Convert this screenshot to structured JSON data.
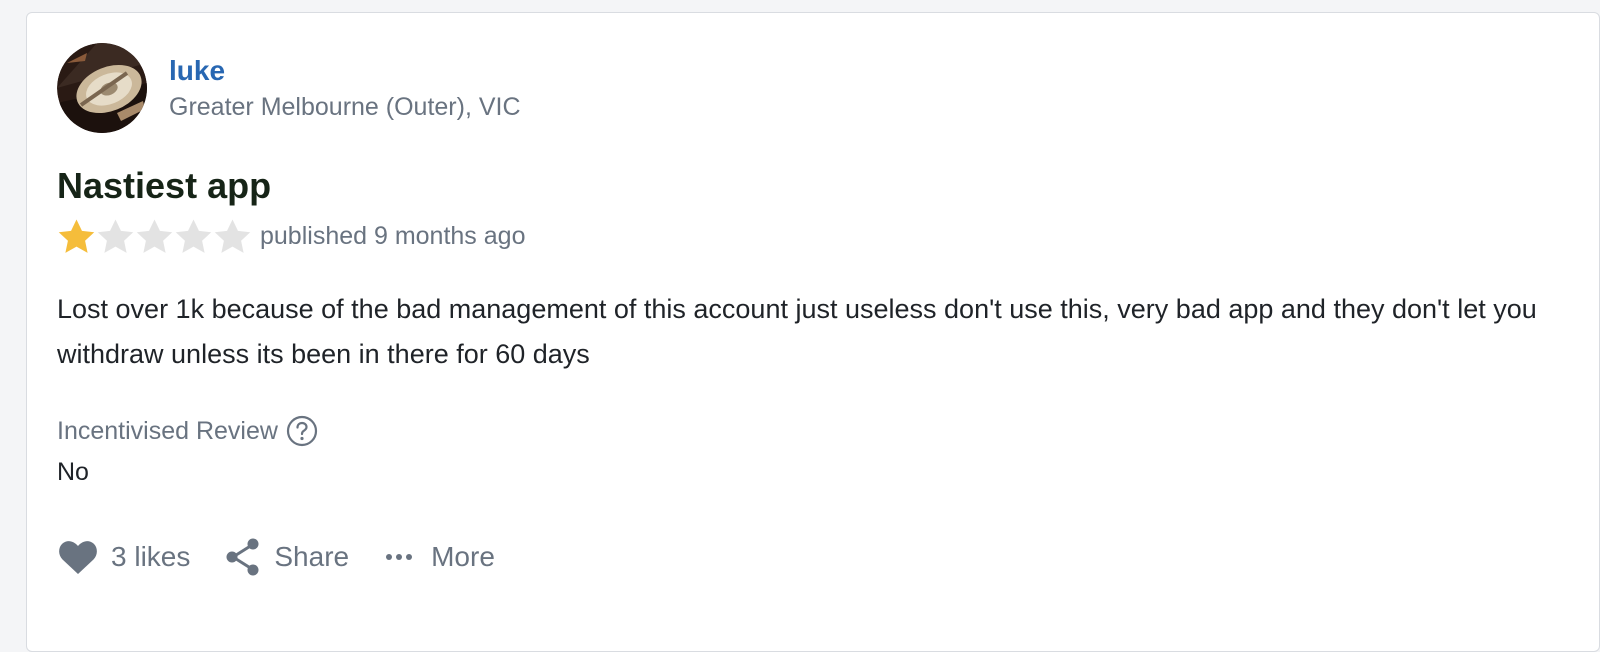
{
  "author": {
    "name": "luke",
    "location": "Greater Melbourne (Outer), VIC"
  },
  "review": {
    "title": "Nastiest app",
    "rating": 1,
    "rating_max": 5,
    "published": "published 9 months ago",
    "body": "Lost over 1k because of the bad management of this account just useless don't use this, very bad app and they don't let you withdraw unless its been in there for 60 days"
  },
  "incentivised": {
    "label": "Incentivised Review",
    "value": "No",
    "help_icon": "question-circle-icon"
  },
  "actions": {
    "likes_label": "3 likes",
    "share_label": "Share",
    "more_label": "More",
    "icons": [
      "heart-icon",
      "share-icon",
      "more-dots-icon"
    ]
  },
  "colors": {
    "author_link": "#2867b2",
    "title": "#162417",
    "muted": "#697380",
    "star_filled": "#f5bd3b",
    "star_empty": "#e3e3e3"
  }
}
